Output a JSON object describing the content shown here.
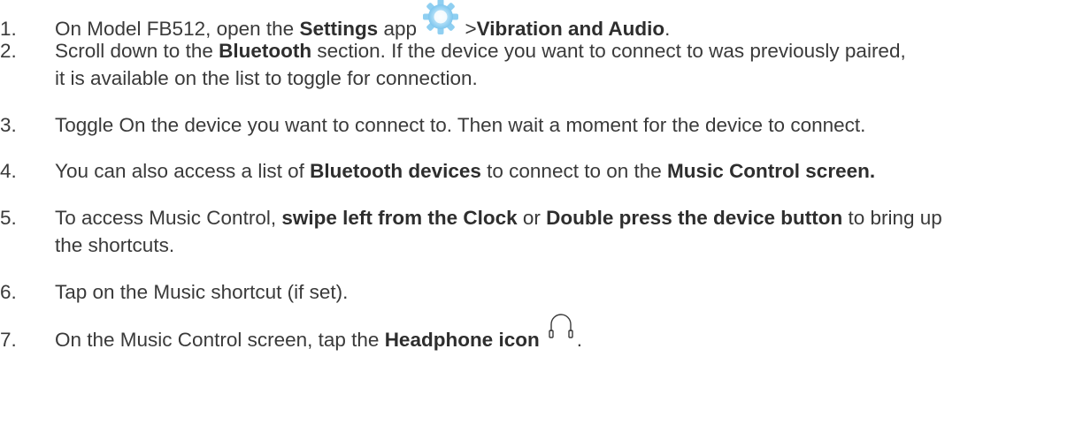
{
  "steps": [
    {
      "number": "1.",
      "p1": "On Model FB512, open the ",
      "b1": "Settings",
      "p2": " app ",
      "p3": " >",
      "b2": "Vibration and Audio",
      "p4": "."
    },
    {
      "number": "2.",
      "p1": "Scroll down to the ",
      "b1": "Bluetooth",
      "p2": " section. If the device you want to connect to was previously paired,",
      "line2": "it is available on the list to toggle for connection."
    },
    {
      "number": "3.",
      "text": "Toggle On the device you want to connect to. Then wait a moment for the device to connect."
    },
    {
      "number": "4.",
      "p1": "You can also access a list of ",
      "b1": "Bluetooth devices",
      "p2": " to connect to on the ",
      "b2": "Music Control screen."
    },
    {
      "number": "5.",
      "p1": "To access Music Control, ",
      "b1": "swipe left from the Clock",
      "p2": " or ",
      "b2": "Double press the device button",
      "p3": " to bring up",
      "line2": "the shortcuts."
    },
    {
      "number": "6.",
      "text": "Tap on the Music shortcut (if set)."
    },
    {
      "number": "7.",
      "p1": "On the Music Control screen, tap the ",
      "b1": "Headphone icon",
      "p2": "."
    }
  ],
  "icons": {
    "settings": "settings-gear-icon",
    "headphone": "headphone-icon"
  },
  "colors": {
    "text": "#3a3a3a",
    "settings_icon_blue": "#7ec6ee"
  }
}
